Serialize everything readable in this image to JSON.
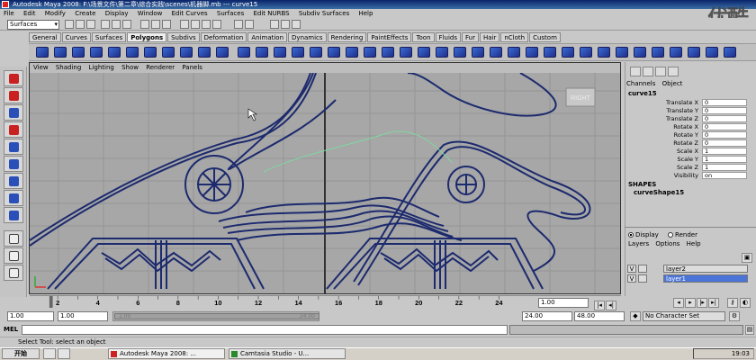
{
  "window": {
    "title": "Autodesk Maya 2008: F:\\场景文件\\第二章\\综合实践\\scenes\\机器脚.mb  ---  curve15",
    "watermark": "优酷"
  },
  "menubar": [
    "File",
    "Edit",
    "Modify",
    "Create",
    "Display",
    "Window",
    "Edit Curves",
    "Surfaces",
    "Edit NURBS",
    "Subdiv Surfaces",
    "Help"
  ],
  "status_line": {
    "mode": "Surfaces"
  },
  "shelf_tabs": [
    {
      "label": "General"
    },
    {
      "label": "Curves"
    },
    {
      "label": "Surfaces"
    },
    {
      "label": "Polygons",
      "active": true
    },
    {
      "label": "Subdivs"
    },
    {
      "label": "Deformation"
    },
    {
      "label": "Animation"
    },
    {
      "label": "Dynamics"
    },
    {
      "label": "Rendering"
    },
    {
      "label": "PaintEffects"
    },
    {
      "label": "Toon"
    },
    {
      "label": "Fluids"
    },
    {
      "label": "Fur"
    },
    {
      "label": "Hair"
    },
    {
      "label": "nCloth"
    },
    {
      "label": "Custom"
    }
  ],
  "viewport": {
    "menu": [
      "View",
      "Shading",
      "Lighting",
      "Show",
      "Renderer",
      "Panels"
    ],
    "view_cube_label": "RIGHT",
    "colors": {
      "bg": "#a7a7a7",
      "grid": "#959595",
      "curves": "#1c2a6e",
      "highlight": "#7fd7a0"
    }
  },
  "time_slider": {
    "ticks": [
      "2",
      "4",
      "6",
      "8",
      "10",
      "12",
      "14",
      "16",
      "18",
      "20",
      "22",
      "24"
    ],
    "current_frame": "1.00"
  },
  "range_slider": {
    "start_time": "1.00",
    "start_playback": "1.00",
    "end_playback": "24.00",
    "end_time": "48.00",
    "slider_left": "1.00",
    "slider_right": "24.00",
    "character_set": "No Character Set"
  },
  "command_line": {
    "label": "MEL"
  },
  "help_line": "Select Tool: select an object",
  "taskbar": {
    "start": "开始",
    "tasks": [
      "Autodesk Maya 2008: ...",
      "Camtasia Studio - U..."
    ],
    "clock": "19:03"
  },
  "channel_box": {
    "menu": [
      "Channels",
      "Object"
    ],
    "node": "curve15",
    "attributes": [
      {
        "label": "Translate X",
        "value": "0"
      },
      {
        "label": "Translate Y",
        "value": "0"
      },
      {
        "label": "Translate Z",
        "value": "0"
      },
      {
        "label": "Rotate X",
        "value": "0"
      },
      {
        "label": "Rotate Y",
        "value": "0"
      },
      {
        "label": "Rotate Z",
        "value": "0"
      },
      {
        "label": "Scale X",
        "value": "1"
      },
      {
        "label": "Scale Y",
        "value": "1"
      },
      {
        "label": "Scale Z",
        "value": "1"
      },
      {
        "label": "Visibility",
        "value": "on"
      }
    ],
    "shapes_header": "SHAPES",
    "shape": "curveShape15"
  },
  "layer_editor": {
    "display_label": "Display",
    "render_label": "Render",
    "menu": [
      "Layers",
      "Options",
      "Help"
    ],
    "layers": [
      {
        "v": "V",
        "name": "layer2",
        "selected": false,
        "color": "#d8d8d8"
      },
      {
        "v": "V",
        "name": "layer1",
        "selected": true,
        "color": "#4a74d8"
      }
    ]
  }
}
